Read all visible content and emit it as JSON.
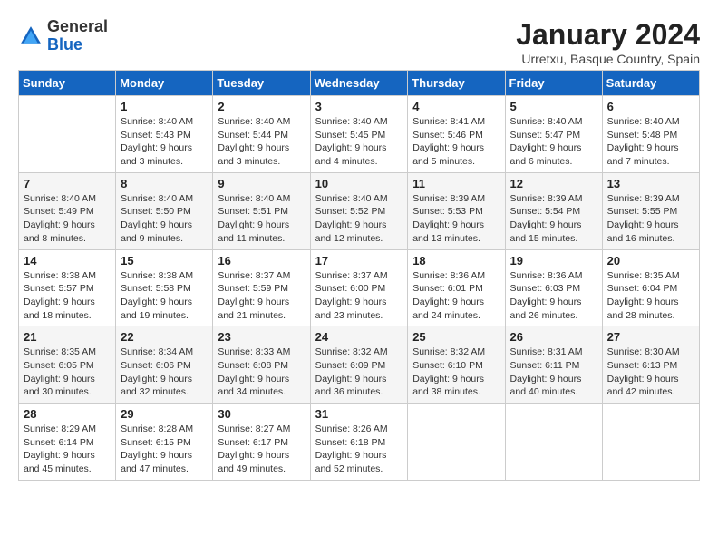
{
  "logo": {
    "general": "General",
    "blue": "Blue"
  },
  "header": {
    "title": "January 2024",
    "subtitle": "Urretxu, Basque Country, Spain"
  },
  "weekdays": [
    "Sunday",
    "Monday",
    "Tuesday",
    "Wednesday",
    "Thursday",
    "Friday",
    "Saturday"
  ],
  "weeks": [
    [
      {
        "day": "",
        "sunrise": "",
        "sunset": "",
        "daylight": ""
      },
      {
        "day": "1",
        "sunrise": "Sunrise: 8:40 AM",
        "sunset": "Sunset: 5:43 PM",
        "daylight": "Daylight: 9 hours and 3 minutes."
      },
      {
        "day": "2",
        "sunrise": "Sunrise: 8:40 AM",
        "sunset": "Sunset: 5:44 PM",
        "daylight": "Daylight: 9 hours and 3 minutes."
      },
      {
        "day": "3",
        "sunrise": "Sunrise: 8:40 AM",
        "sunset": "Sunset: 5:45 PM",
        "daylight": "Daylight: 9 hours and 4 minutes."
      },
      {
        "day": "4",
        "sunrise": "Sunrise: 8:41 AM",
        "sunset": "Sunset: 5:46 PM",
        "daylight": "Daylight: 9 hours and 5 minutes."
      },
      {
        "day": "5",
        "sunrise": "Sunrise: 8:40 AM",
        "sunset": "Sunset: 5:47 PM",
        "daylight": "Daylight: 9 hours and 6 minutes."
      },
      {
        "day": "6",
        "sunrise": "Sunrise: 8:40 AM",
        "sunset": "Sunset: 5:48 PM",
        "daylight": "Daylight: 9 hours and 7 minutes."
      }
    ],
    [
      {
        "day": "7",
        "sunrise": "Sunrise: 8:40 AM",
        "sunset": "Sunset: 5:49 PM",
        "daylight": "Daylight: 9 hours and 8 minutes."
      },
      {
        "day": "8",
        "sunrise": "Sunrise: 8:40 AM",
        "sunset": "Sunset: 5:50 PM",
        "daylight": "Daylight: 9 hours and 9 minutes."
      },
      {
        "day": "9",
        "sunrise": "Sunrise: 8:40 AM",
        "sunset": "Sunset: 5:51 PM",
        "daylight": "Daylight: 9 hours and 11 minutes."
      },
      {
        "day": "10",
        "sunrise": "Sunrise: 8:40 AM",
        "sunset": "Sunset: 5:52 PM",
        "daylight": "Daylight: 9 hours and 12 minutes."
      },
      {
        "day": "11",
        "sunrise": "Sunrise: 8:39 AM",
        "sunset": "Sunset: 5:53 PM",
        "daylight": "Daylight: 9 hours and 13 minutes."
      },
      {
        "day": "12",
        "sunrise": "Sunrise: 8:39 AM",
        "sunset": "Sunset: 5:54 PM",
        "daylight": "Daylight: 9 hours and 15 minutes."
      },
      {
        "day": "13",
        "sunrise": "Sunrise: 8:39 AM",
        "sunset": "Sunset: 5:55 PM",
        "daylight": "Daylight: 9 hours and 16 minutes."
      }
    ],
    [
      {
        "day": "14",
        "sunrise": "Sunrise: 8:38 AM",
        "sunset": "Sunset: 5:57 PM",
        "daylight": "Daylight: 9 hours and 18 minutes."
      },
      {
        "day": "15",
        "sunrise": "Sunrise: 8:38 AM",
        "sunset": "Sunset: 5:58 PM",
        "daylight": "Daylight: 9 hours and 19 minutes."
      },
      {
        "day": "16",
        "sunrise": "Sunrise: 8:37 AM",
        "sunset": "Sunset: 5:59 PM",
        "daylight": "Daylight: 9 hours and 21 minutes."
      },
      {
        "day": "17",
        "sunrise": "Sunrise: 8:37 AM",
        "sunset": "Sunset: 6:00 PM",
        "daylight": "Daylight: 9 hours and 23 minutes."
      },
      {
        "day": "18",
        "sunrise": "Sunrise: 8:36 AM",
        "sunset": "Sunset: 6:01 PM",
        "daylight": "Daylight: 9 hours and 24 minutes."
      },
      {
        "day": "19",
        "sunrise": "Sunrise: 8:36 AM",
        "sunset": "Sunset: 6:03 PM",
        "daylight": "Daylight: 9 hours and 26 minutes."
      },
      {
        "day": "20",
        "sunrise": "Sunrise: 8:35 AM",
        "sunset": "Sunset: 6:04 PM",
        "daylight": "Daylight: 9 hours and 28 minutes."
      }
    ],
    [
      {
        "day": "21",
        "sunrise": "Sunrise: 8:35 AM",
        "sunset": "Sunset: 6:05 PM",
        "daylight": "Daylight: 9 hours and 30 minutes."
      },
      {
        "day": "22",
        "sunrise": "Sunrise: 8:34 AM",
        "sunset": "Sunset: 6:06 PM",
        "daylight": "Daylight: 9 hours and 32 minutes."
      },
      {
        "day": "23",
        "sunrise": "Sunrise: 8:33 AM",
        "sunset": "Sunset: 6:08 PM",
        "daylight": "Daylight: 9 hours and 34 minutes."
      },
      {
        "day": "24",
        "sunrise": "Sunrise: 8:32 AM",
        "sunset": "Sunset: 6:09 PM",
        "daylight": "Daylight: 9 hours and 36 minutes."
      },
      {
        "day": "25",
        "sunrise": "Sunrise: 8:32 AM",
        "sunset": "Sunset: 6:10 PM",
        "daylight": "Daylight: 9 hours and 38 minutes."
      },
      {
        "day": "26",
        "sunrise": "Sunrise: 8:31 AM",
        "sunset": "Sunset: 6:11 PM",
        "daylight": "Daylight: 9 hours and 40 minutes."
      },
      {
        "day": "27",
        "sunrise": "Sunrise: 8:30 AM",
        "sunset": "Sunset: 6:13 PM",
        "daylight": "Daylight: 9 hours and 42 minutes."
      }
    ],
    [
      {
        "day": "28",
        "sunrise": "Sunrise: 8:29 AM",
        "sunset": "Sunset: 6:14 PM",
        "daylight": "Daylight: 9 hours and 45 minutes."
      },
      {
        "day": "29",
        "sunrise": "Sunrise: 8:28 AM",
        "sunset": "Sunset: 6:15 PM",
        "daylight": "Daylight: 9 hours and 47 minutes."
      },
      {
        "day": "30",
        "sunrise": "Sunrise: 8:27 AM",
        "sunset": "Sunset: 6:17 PM",
        "daylight": "Daylight: 9 hours and 49 minutes."
      },
      {
        "day": "31",
        "sunrise": "Sunrise: 8:26 AM",
        "sunset": "Sunset: 6:18 PM",
        "daylight": "Daylight: 9 hours and 52 minutes."
      },
      {
        "day": "",
        "sunrise": "",
        "sunset": "",
        "daylight": ""
      },
      {
        "day": "",
        "sunrise": "",
        "sunset": "",
        "daylight": ""
      },
      {
        "day": "",
        "sunrise": "",
        "sunset": "",
        "daylight": ""
      }
    ]
  ]
}
